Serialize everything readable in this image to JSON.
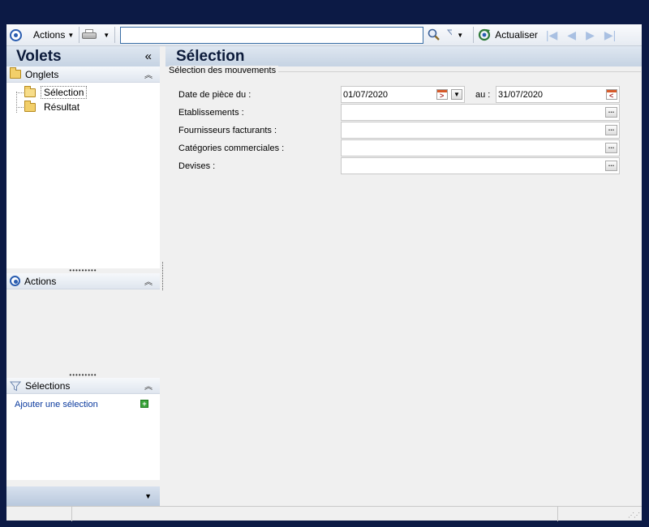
{
  "toolbar": {
    "actions_label": "Actions",
    "search_value": "",
    "refresh_label": "Actualiser"
  },
  "left": {
    "title": "Volets",
    "collapse_glyph": "«",
    "onglets": {
      "header": "Onglets",
      "items": [
        {
          "label": "Sélection"
        },
        {
          "label": "Résultat"
        }
      ]
    },
    "actions": {
      "header": "Actions"
    },
    "selections": {
      "header": "Sélections",
      "add_link": "Ajouter une sélection"
    }
  },
  "main": {
    "title": "Sélection",
    "group_label": "Sélection des mouvements",
    "fields": {
      "date_label": "Date de pièce du :",
      "date_from": "01/07/2020",
      "date_to_label": "au :",
      "date_to": "31/07/2020",
      "etablissements_label": "Etablissements :",
      "fournisseurs_label": "Fournisseurs facturants :",
      "categories_label": "Catégories commerciales :",
      "devises_label": "Devises :"
    }
  },
  "colors": {
    "frame": "#0c1a45",
    "header_title": "#0b1a3a",
    "link": "#0b3a9e",
    "accent_blue": "#2a5db0"
  }
}
